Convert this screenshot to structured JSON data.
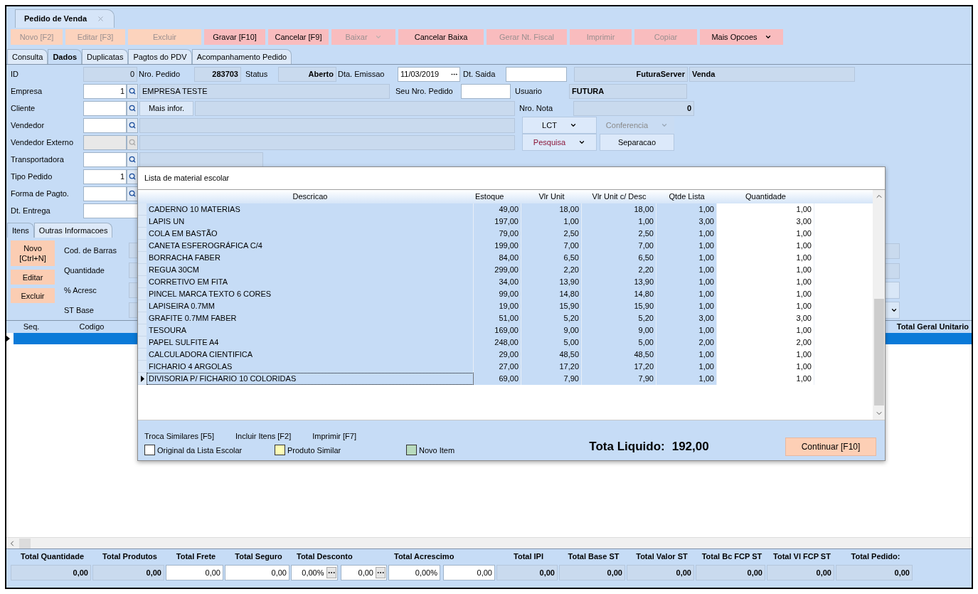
{
  "document_tab": {
    "title": "Pedido de Venda"
  },
  "toolbar": [
    {
      "label": "Novo [F2]",
      "disabled": true,
      "dropdown": false,
      "color": "#fcd3bd"
    },
    {
      "label": "Editar [F3]",
      "disabled": true,
      "dropdown": false,
      "color": "#fcd3bd"
    },
    {
      "label": "Excluir",
      "disabled": true,
      "dropdown": false,
      "color": "#fcd3bd"
    },
    {
      "label": "Gravar [F10]",
      "disabled": false,
      "dropdown": false,
      "color": "#f9bcbe"
    },
    {
      "label": "Cancelar [F9]",
      "disabled": false,
      "dropdown": false,
      "color": "#f9bcbe"
    },
    {
      "label": "Baixar",
      "disabled": true,
      "dropdown": true,
      "color": "#f9bcbe"
    },
    {
      "label": "Cancelar Baixa",
      "disabled": false,
      "dropdown": false,
      "color": "#f9bcbe"
    },
    {
      "label": "Gerar Nt. Fiscal",
      "disabled": true,
      "dropdown": false,
      "color": "#f9bcbe"
    },
    {
      "label": "Imprimir",
      "disabled": true,
      "dropdown": false,
      "color": "#f9bcbe"
    },
    {
      "label": "Copiar",
      "disabled": true,
      "dropdown": false,
      "color": "#f9bcbe"
    },
    {
      "label": "Mais Opcoes",
      "disabled": false,
      "dropdown": true,
      "color": "#f9bcbe"
    }
  ],
  "tabs": [
    {
      "label": "Consulta",
      "selected": false
    },
    {
      "label": "Dados",
      "selected": true
    },
    {
      "label": "Duplicatas",
      "selected": false
    },
    {
      "label": "Pagtos do PDV",
      "selected": false
    },
    {
      "label": "Acompanhamento Pedido",
      "selected": false
    }
  ],
  "header": {
    "id": {
      "label": "ID",
      "value": "0"
    },
    "nro_pedido": {
      "label": "Nro. Pedido",
      "value": "283703"
    },
    "status": {
      "label": "Status",
      "value": "Aberto"
    },
    "dta_emissao": {
      "label": "Dta. Emissao",
      "value": "11/03/2019"
    },
    "dt_saida": {
      "label": "Dt. Saida"
    },
    "server": "FuturaServer",
    "operation": "Venda",
    "empresa": {
      "label": "Empresa",
      "code": "1",
      "name": "EMPRESA TESTE"
    },
    "seu_nro_pedido": {
      "label": "Seu Nro. Pedido"
    },
    "usuario": {
      "label": "Usuario",
      "value": "FUTURA"
    },
    "cliente": {
      "label": "Cliente",
      "button": "Mais infor."
    },
    "nro_nota": {
      "label": "Nro. Nota",
      "value": "0"
    },
    "vendedor": {
      "label": "Vendedor"
    },
    "vendedor_externo": {
      "label": "Vendedor Externo",
      "disabled": true
    },
    "transportadora": {
      "label": "Transportadora"
    },
    "tipo_pedido": {
      "label": "Tipo Pedido",
      "code": "1"
    },
    "forma_pagto": {
      "label": "Forma de Pagto."
    },
    "dt_entrega": {
      "label": "Dt. Entrega"
    }
  },
  "side_buttons": [
    {
      "label": "LCT",
      "disabled": false,
      "dropdown": true,
      "color": "#000000"
    },
    {
      "label": "Conferencia",
      "disabled": true,
      "dropdown": true,
      "color": "#8a8a8a"
    },
    {
      "label": "Pesquisa",
      "disabled": false,
      "dropdown": true,
      "color": "#8b1538"
    },
    {
      "label": "Separacao",
      "disabled": false,
      "dropdown": false,
      "color": "#000000"
    }
  ],
  "item_tabs": [
    {
      "label": "Itens",
      "selected": true
    },
    {
      "label": "Outras Informacoes",
      "selected": false
    }
  ],
  "item_buttons": [
    "Novo [Ctrl+N]",
    "Editar",
    "Excluir"
  ],
  "item_fields": [
    "Cod. de Barras",
    "Quantidade",
    "% Acresc",
    "ST Base"
  ],
  "items_grid": {
    "columns": [
      "Seq.",
      "Codigo",
      "Total Geral Unitario"
    ],
    "rows": [
      {
        "selected": true
      }
    ]
  },
  "totals": [
    {
      "label": "Total Quantidade",
      "values": [
        {
          "kind": "readonly",
          "value": "0,00"
        }
      ]
    },
    {
      "label": "Total Produtos",
      "values": [
        {
          "kind": "readonly",
          "value": "0,00"
        }
      ]
    },
    {
      "label": "Total Frete",
      "values": [
        {
          "kind": "input",
          "value": "0,00"
        }
      ]
    },
    {
      "label": "Total Seguro",
      "values": [
        {
          "kind": "input",
          "value": "0,00"
        }
      ]
    },
    {
      "label": "Total Desconto",
      "values": [
        {
          "kind": "picker",
          "value": "0,00%"
        },
        {
          "kind": "picker",
          "value": "0,00"
        }
      ]
    },
    {
      "label": "Total Acrescimo",
      "values": [
        {
          "kind": "input",
          "value": "0,00%"
        },
        {
          "kind": "input",
          "value": "0,00"
        }
      ]
    },
    {
      "label": "Total IPI",
      "values": [
        {
          "kind": "readonly",
          "value": "0,00"
        }
      ]
    },
    {
      "label": "Total Base ST",
      "values": [
        {
          "kind": "readonly",
          "value": "0,00"
        }
      ]
    },
    {
      "label": "Total Valor ST",
      "values": [
        {
          "kind": "readonly",
          "value": "0,00"
        }
      ]
    },
    {
      "label": "Total Bc FCP ST",
      "values": [
        {
          "kind": "readonly",
          "value": "0,00"
        }
      ]
    },
    {
      "label": "Total Vl FCP ST",
      "values": [
        {
          "kind": "readonly",
          "value": "0,00"
        }
      ]
    },
    {
      "label": "Total Pedido:",
      "values": [
        {
          "kind": "readonly",
          "value": "0,00"
        }
      ]
    }
  ],
  "modal": {
    "title": "Lista de material escolar",
    "columns": [
      "Descricao",
      "Estoque",
      "Vlr Unit",
      "Vlr Unit c/ Desc",
      "Qtde Lista",
      "Quantidade"
    ],
    "rows": [
      {
        "descricao": "CADERNO 10 MATERIAS",
        "estoque": "49,00",
        "vlr_unit": "18,00",
        "vlr_unit_desc": "18,00",
        "qtde_lista": "1,00",
        "quantidade": "1,00",
        "selected": false
      },
      {
        "descricao": "LAPIS UN",
        "estoque": "197,00",
        "vlr_unit": "1,00",
        "vlr_unit_desc": "1,00",
        "qtde_lista": "3,00",
        "quantidade": "3,00",
        "selected": false
      },
      {
        "descricao": "COLA EM BASTÃO",
        "estoque": "79,00",
        "vlr_unit": "2,50",
        "vlr_unit_desc": "2,50",
        "qtde_lista": "1,00",
        "quantidade": "1,00",
        "selected": false
      },
      {
        "descricao": "CANETA ESFEROGRÁFICA C/4",
        "estoque": "199,00",
        "vlr_unit": "7,00",
        "vlr_unit_desc": "7,00",
        "qtde_lista": "1,00",
        "quantidade": "1,00",
        "selected": false
      },
      {
        "descricao": "BORRACHA FABER",
        "estoque": "84,00",
        "vlr_unit": "6,50",
        "vlr_unit_desc": "6,50",
        "qtde_lista": "1,00",
        "quantidade": "1,00",
        "selected": false
      },
      {
        "descricao": "REGUA 30CM",
        "estoque": "299,00",
        "vlr_unit": "2,20",
        "vlr_unit_desc": "2,20",
        "qtde_lista": "1,00",
        "quantidade": "1,00",
        "selected": false
      },
      {
        "descricao": "CORRETIVO EM FITA",
        "estoque": "34,00",
        "vlr_unit": "13,90",
        "vlr_unit_desc": "13,90",
        "qtde_lista": "1,00",
        "quantidade": "1,00",
        "selected": false
      },
      {
        "descricao": "PINCEL MARCA TEXTO 6 CORES",
        "estoque": "99,00",
        "vlr_unit": "14,80",
        "vlr_unit_desc": "14,80",
        "qtde_lista": "1,00",
        "quantidade": "1,00",
        "selected": false
      },
      {
        "descricao": "LAPISEIRA 0.7MM",
        "estoque": "19,00",
        "vlr_unit": "15,90",
        "vlr_unit_desc": "15,90",
        "qtde_lista": "1,00",
        "quantidade": "1,00",
        "selected": false
      },
      {
        "descricao": "GRAFITE 0.7MM FABER",
        "estoque": "51,00",
        "vlr_unit": "5,20",
        "vlr_unit_desc": "5,20",
        "qtde_lista": "3,00",
        "quantidade": "3,00",
        "selected": false
      },
      {
        "descricao": "TESOURA",
        "estoque": "169,00",
        "vlr_unit": "9,00",
        "vlr_unit_desc": "9,00",
        "qtde_lista": "1,00",
        "quantidade": "1,00",
        "selected": false
      },
      {
        "descricao": "PAPEL SULFITE A4",
        "estoque": "248,00",
        "vlr_unit": "5,00",
        "vlr_unit_desc": "5,00",
        "qtde_lista": "2,00",
        "quantidade": "2,00",
        "selected": false
      },
      {
        "descricao": "CALCULADORA CIENTIFICA",
        "estoque": "29,00",
        "vlr_unit": "48,50",
        "vlr_unit_desc": "48,50",
        "qtde_lista": "1,00",
        "quantidade": "1,00",
        "selected": false
      },
      {
        "descricao": "FICHARIO 4 ARGOLAS",
        "estoque": "27,00",
        "vlr_unit": "17,20",
        "vlr_unit_desc": "17,20",
        "qtde_lista": "1,00",
        "quantidade": "1,00",
        "selected": false
      },
      {
        "descricao": "DIVISORIA P/ FICHARIO 10 COLORIDAS",
        "estoque": "69,00",
        "vlr_unit": "7,90",
        "vlr_unit_desc": "7,90",
        "qtde_lista": "1,00",
        "quantidade": "1,00",
        "selected": true
      }
    ],
    "footer_actions": [
      "Troca Similares [F5]",
      "Incluir Itens [F2]",
      "Imprimir [F7]"
    ],
    "legend": [
      {
        "label": "Original da Lista Escolar",
        "color": "#ffffff"
      },
      {
        "label": "Produto Similar",
        "color": "#fdfdb5"
      },
      {
        "label": "Novo Item",
        "color": "#b8dbbd"
      }
    ],
    "total_label": "Tota Liquido:",
    "total_value": "192,00",
    "continue_button": "Continuar [F10]"
  }
}
